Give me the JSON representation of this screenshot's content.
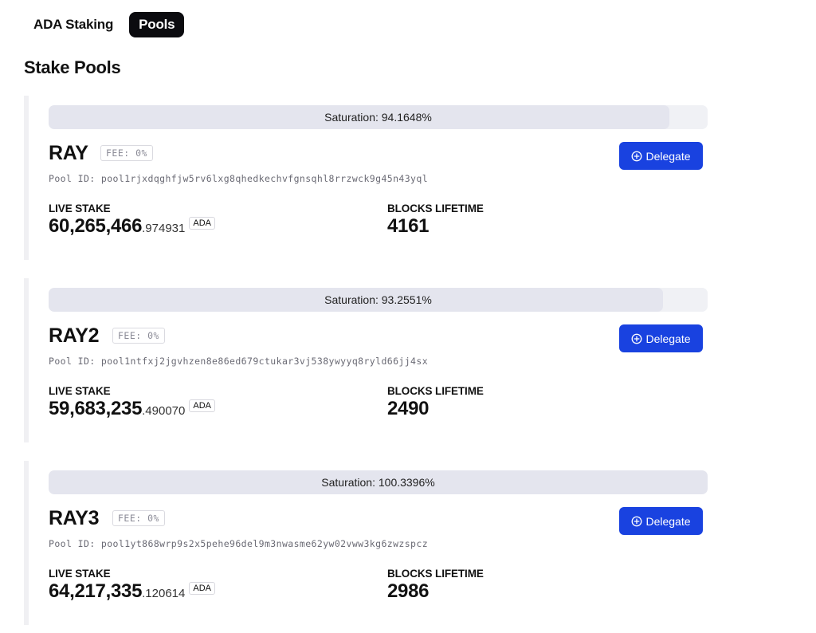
{
  "tabs": [
    {
      "label": "ADA Staking",
      "active": false
    },
    {
      "label": "Pools",
      "active": true
    }
  ],
  "page_title": "Stake Pools",
  "labels": {
    "live_stake": "LIVE STAKE",
    "blocks_lifetime": "BLOCKS LIFETIME",
    "delegate": "Delegate",
    "currency": "ADA"
  },
  "colors": {
    "accent": "#1942e0",
    "tab_active_bg": "#0b0b0f"
  },
  "pools": [
    {
      "name": "RAY",
      "fee": "FEE: 0%",
      "pool_id": "Pool ID: pool1rjxdqghfjw5rv6lxg8qhedkechvfgnsqhl8rrzwck9g45n43yql",
      "saturation_label": "Saturation: 94.1648%",
      "saturation_percent": 94.1648,
      "live_stake_int": "60,265,466",
      "live_stake_dec": ".974931",
      "blocks_lifetime": "4161"
    },
    {
      "name": "RAY2",
      "fee": "FEE: 0%",
      "pool_id": "Pool ID: pool1ntfxj2jgvhzen8e86ed679ctukar3vj538ywyyq8ryld66jj4sx",
      "saturation_label": "Saturation: 93.2551%",
      "saturation_percent": 93.2551,
      "live_stake_int": "59,683,235",
      "live_stake_dec": ".490070",
      "blocks_lifetime": "2490"
    },
    {
      "name": "RAY3",
      "fee": "FEE: 0%",
      "pool_id": "Pool ID: pool1yt868wrp9s2x5pehe96del9m3nwasme62yw02vww3kg6zwzspcz",
      "saturation_label": "Saturation: 100.3396%",
      "saturation_percent": 100.3396,
      "live_stake_int": "64,217,335",
      "live_stake_dec": ".120614",
      "blocks_lifetime": "2986"
    }
  ]
}
